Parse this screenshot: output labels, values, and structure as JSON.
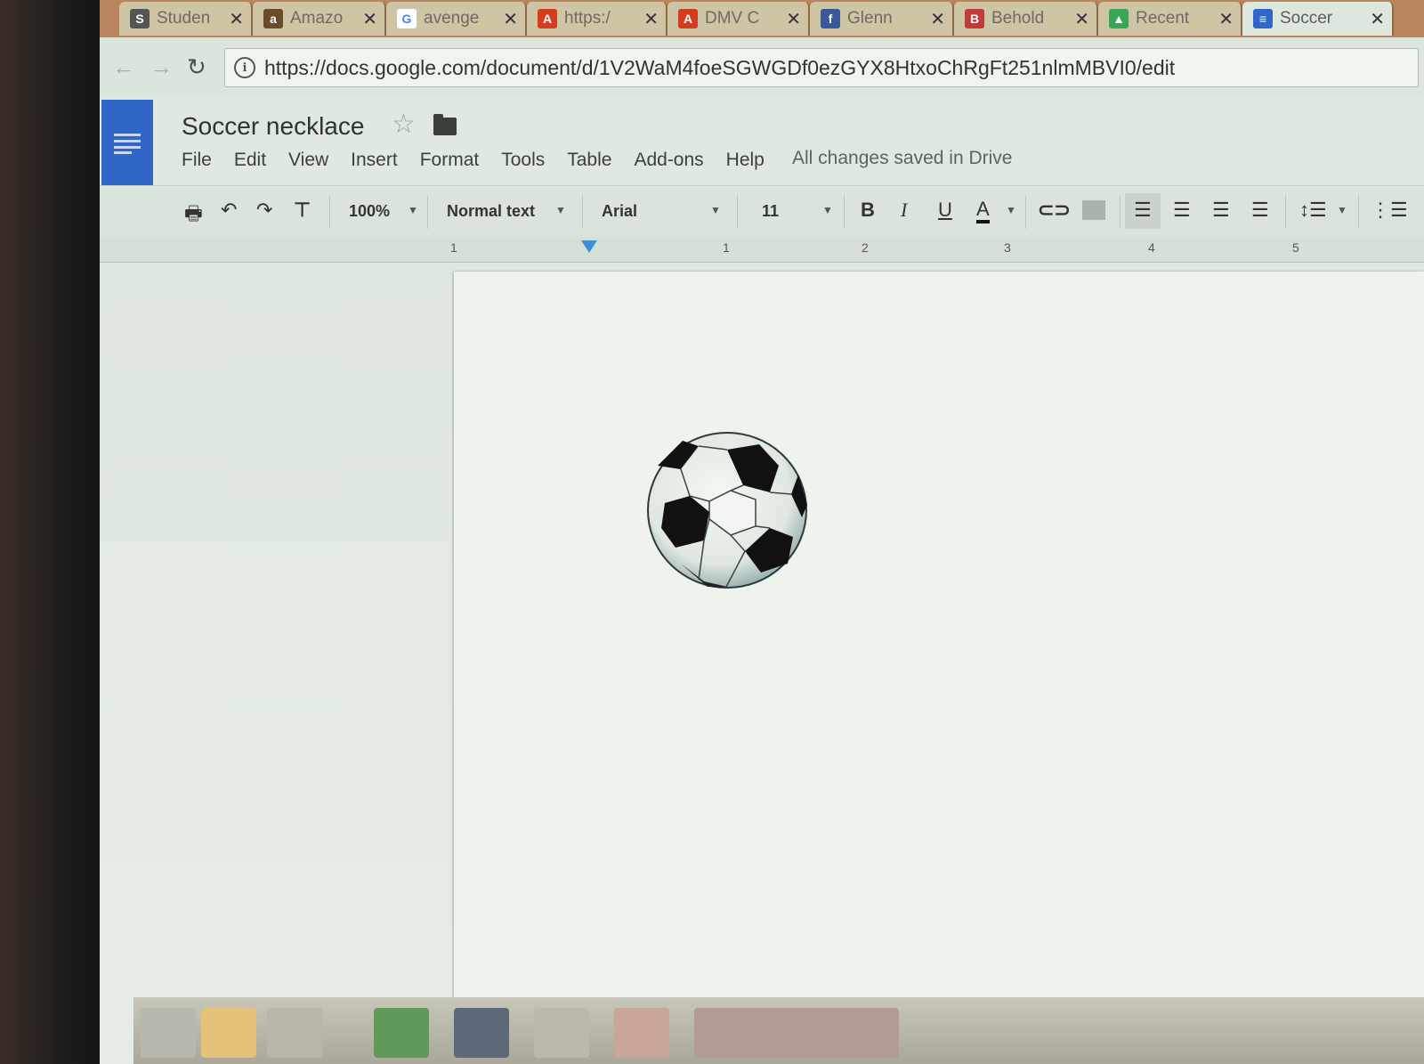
{
  "browser": {
    "tabs": [
      {
        "title": "Studen",
        "favicon": "student-portal-icon",
        "color": "#555555",
        "glyph": "S"
      },
      {
        "title": "Amazo",
        "favicon": "amazon-icon",
        "color": "#6b4a2b",
        "glyph": "a"
      },
      {
        "title": "avenge",
        "favicon": "google-icon",
        "color": "#4285f4",
        "glyph": "G"
      },
      {
        "title": "https:/",
        "favicon": "acrobat-icon",
        "color": "#d53b1f",
        "glyph": "A"
      },
      {
        "title": "DMV C",
        "favicon": "acrobat-icon",
        "color": "#d53b1f",
        "glyph": "A"
      },
      {
        "title": "Glenn",
        "favicon": "facebook-icon",
        "color": "#3b5998",
        "glyph": "f"
      },
      {
        "title": "Behold",
        "favicon": "behold-icon",
        "color": "#c23b3b",
        "glyph": "B"
      },
      {
        "title": "Recent",
        "favicon": "drive-icon",
        "color": "#3aa657",
        "glyph": "▲"
      },
      {
        "title": "Soccer",
        "favicon": "docs-icon",
        "color": "#3166c9",
        "glyph": "≡"
      }
    ],
    "active_tab": 8,
    "url": "https://docs.google.com/document/d/1V2WaM4foeSGWGDf0ezGYX8HtxoChRgFt251nlmMBVI0/edit"
  },
  "docs": {
    "title": "Soccer necklace",
    "menu": [
      "File",
      "Edit",
      "View",
      "Insert",
      "Format",
      "Tools",
      "Table",
      "Add-ons",
      "Help"
    ],
    "save_status": "All changes saved in Drive",
    "toolbar": {
      "zoom": "100%",
      "style": "Normal text",
      "font": "Arial",
      "size": "11",
      "bold": "B",
      "italic": "I",
      "underline": "U",
      "text_color": "A"
    },
    "ruler_numbers": [
      "1",
      "1",
      "2",
      "3",
      "4",
      "5"
    ]
  }
}
